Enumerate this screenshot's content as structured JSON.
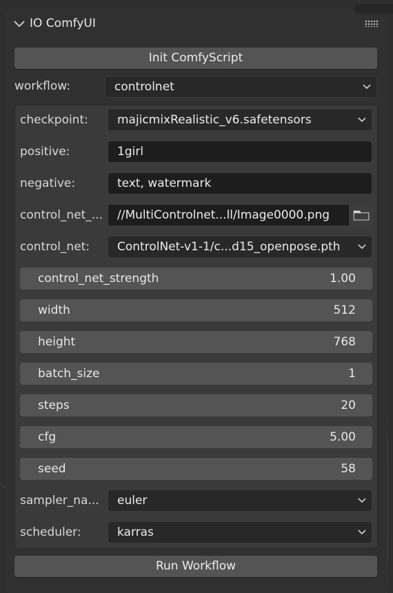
{
  "panel": {
    "title": "IO ComfyUI",
    "init_button": "Init ComfyScript",
    "workflow_label": "workflow:",
    "workflow_value": "controlnet",
    "run_button": "Run Workflow"
  },
  "params": {
    "checkpoint": {
      "label": "checkpoint:",
      "value": "majicmixRealistic_v6.safetensors"
    },
    "positive": {
      "label": "positive:",
      "value": "1girl"
    },
    "negative": {
      "label": "negative:",
      "value": "text, watermark"
    },
    "control_net_image": {
      "label": "control_net_...",
      "value": "//MultiControlnet...ll/Image0000.png"
    },
    "control_net": {
      "label": "control_net:",
      "value": "ControlNet-v1-1/c...d15_openpose.pth"
    },
    "sliders": [
      {
        "name": "control_net_strength",
        "value": "1.00"
      },
      {
        "name": "width",
        "value": "512"
      },
      {
        "name": "height",
        "value": "768"
      },
      {
        "name": "batch_size",
        "value": "1"
      },
      {
        "name": "steps",
        "value": "20"
      },
      {
        "name": "cfg",
        "value": "5.00"
      },
      {
        "name": "seed",
        "value": "58"
      }
    ],
    "sampler_name": {
      "label": "sampler_na...",
      "value": "euler"
    },
    "scheduler": {
      "label": "scheduler:",
      "value": "karras"
    }
  },
  "icons": [
    "chevron-down-icon",
    "grip-icon",
    "folder-icon",
    "dropdown-caret-icon"
  ]
}
